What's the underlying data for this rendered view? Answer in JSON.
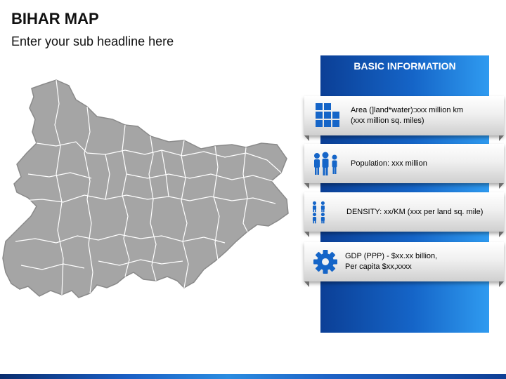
{
  "slide": {
    "title": "BIHAR MAP",
    "subtitle": "Enter your sub headline here"
  },
  "map": {
    "region": "Bihar",
    "fill_color": "#a5a5a5",
    "border_color": "#ffffff"
  },
  "info": {
    "heading": "BASIC INFORMATION",
    "accent_color": "#1565c8",
    "items": [
      {
        "icon": "grid-blocks-icon",
        "lines": [
          "Area (]land*water):xxx million km",
          "(xxx million sq. miles)"
        ]
      },
      {
        "icon": "people-group-icon",
        "lines": [
          "Population: xxx million"
        ]
      },
      {
        "icon": "density-people-icon",
        "lines": [
          "DENSITY: xx/KM (xxx per land sq. mile)"
        ]
      },
      {
        "icon": "gear-icon",
        "lines": [
          "GDP (PPP) - $xx.xx billion,",
          "Per capita $xx,xxxx"
        ]
      }
    ]
  }
}
